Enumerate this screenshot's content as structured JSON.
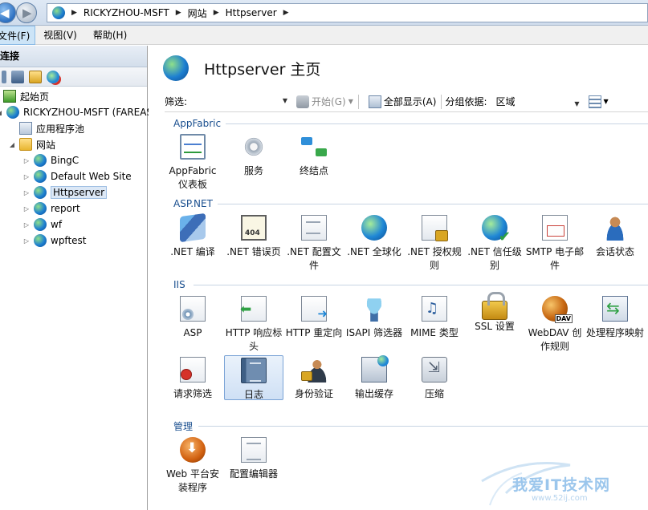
{
  "address": {
    "crumbs": [
      "RICKYZHOU-MSFT",
      "网站",
      "Httpserver"
    ]
  },
  "menu": {
    "file": "文件(F)",
    "view": "视图(V)",
    "help": "帮助(H)"
  },
  "connections": {
    "header": "连接",
    "tree": {
      "start_page": "起始页",
      "server": "RICKYZHOU-MSFT (FAREAST\\rickyzhou)",
      "app_pools": "应用程序池",
      "sites": "网站",
      "site_items": [
        "BingC",
        "Default Web Site",
        "Httpserver",
        "report",
        "wf",
        "wpftest"
      ],
      "selected": "Httpserver"
    }
  },
  "main": {
    "title": "Httpserver 主页",
    "filter": {
      "label": "筛选:",
      "value": "",
      "go": "开始(G)",
      "show_all": "全部显示(A)",
      "group_by_label": "分组依据:",
      "group_by_value": "区域"
    },
    "groups": [
      {
        "name": "AppFabric",
        "features": [
          {
            "label": "AppFabric 仪表板",
            "icon": "dashboard-icon"
          },
          {
            "label": "服务",
            "icon": "services-gear-icon"
          },
          {
            "label": "终结点",
            "icon": "endpoints-icon"
          }
        ]
      },
      {
        "name": "ASP.NET",
        "features": [
          {
            "label": ".NET 编译",
            "icon": "dotnet-compilation-icon"
          },
          {
            "label": ".NET 错误页",
            "icon": "error-page-404-icon"
          },
          {
            "label": ".NET 配置文件",
            "icon": "profile-icon"
          },
          {
            "label": ".NET 全球化",
            "icon": "globalization-icon"
          },
          {
            "label": ".NET 授权规则",
            "icon": "authorization-rules-icon"
          },
          {
            "label": ".NET 信任级别",
            "icon": "trust-levels-icon"
          },
          {
            "label": "SMTP 电子邮件",
            "icon": "smtp-email-icon"
          },
          {
            "label": "会话状态",
            "icon": "session-state-icon"
          }
        ]
      },
      {
        "name": "IIS",
        "features": [
          {
            "label": "ASP",
            "icon": "asp-icon"
          },
          {
            "label": "HTTP 响应标头",
            "icon": "http-response-headers-icon"
          },
          {
            "label": "HTTP 重定向",
            "icon": "http-redirect-icon"
          },
          {
            "label": "ISAPI 筛选器",
            "icon": "isapi-filters-icon"
          },
          {
            "label": "MIME 类型",
            "icon": "mime-types-icon"
          },
          {
            "label": "SSL 设置",
            "icon": "ssl-lock-icon"
          },
          {
            "label": "WebDAV 创作规则",
            "icon": "webdav-icon"
          },
          {
            "label": "处理程序映射",
            "icon": "handler-mappings-icon"
          },
          {
            "label": "请求筛选",
            "icon": "request-filtering-icon"
          },
          {
            "label": "日志",
            "icon": "logging-icon"
          },
          {
            "label": "身份验证",
            "icon": "authentication-icon"
          },
          {
            "label": "输出缓存",
            "icon": "output-caching-icon"
          },
          {
            "label": "压缩",
            "icon": "compression-icon"
          }
        ]
      },
      {
        "name": "管理",
        "features": [
          {
            "label": "Web 平台安装程序",
            "icon": "web-platform-installer-icon"
          },
          {
            "label": "配置编辑器",
            "icon": "configuration-editor-icon"
          }
        ]
      }
    ],
    "selected_feature": "日志"
  },
  "watermark": {
    "title": "我爱IT技术网",
    "url": "www.52ij.com"
  }
}
